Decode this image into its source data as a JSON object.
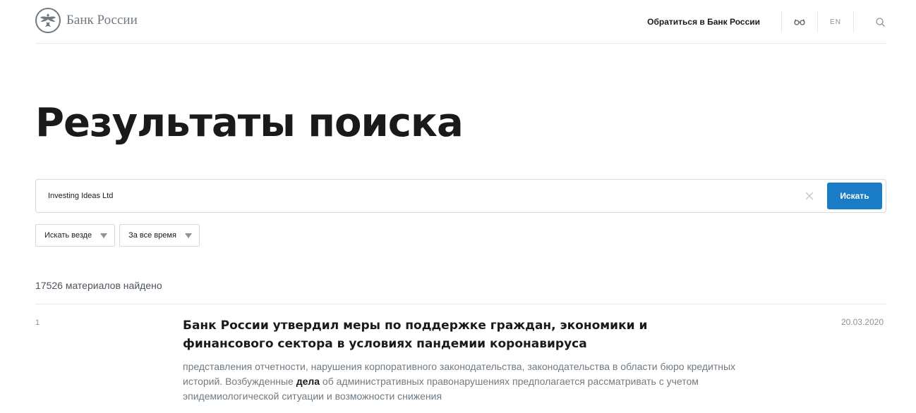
{
  "header": {
    "logo_text": "Банк России",
    "contact_link": "Обратиться в Банк России",
    "lang_label": "EN",
    "icons": [
      "glasses-icon",
      "search-icon"
    ]
  },
  "page": {
    "title": "Результаты поиска"
  },
  "search": {
    "value": "Investing Ideas Ltd",
    "button_label": "Искать"
  },
  "filters": [
    {
      "label": "Искать везде"
    },
    {
      "label": "За все время"
    }
  ],
  "results": {
    "count_text": "17526 материалов найдено",
    "items": [
      {
        "number": "1",
        "title": "Банк России утвердил меры по поддержке граждан, экономики и финансового сектора в условиях пандемии коронавируса",
        "date": "20.03.2020",
        "snippet_before": "представления отчетности, нарушения корпоративного законодательства, законодательства в области бюро кредитных историй. Возбужденные ",
        "snippet_highlight": "дела",
        "snippet_after": " об административных правонарушениях предполагается рассматривать с учетом эпидемиологической ситуации и возможности снижения"
      }
    ]
  },
  "colors": {
    "accent": "#1a7bc6",
    "muted_text": "#707a82",
    "border": "#d5d8dc"
  }
}
